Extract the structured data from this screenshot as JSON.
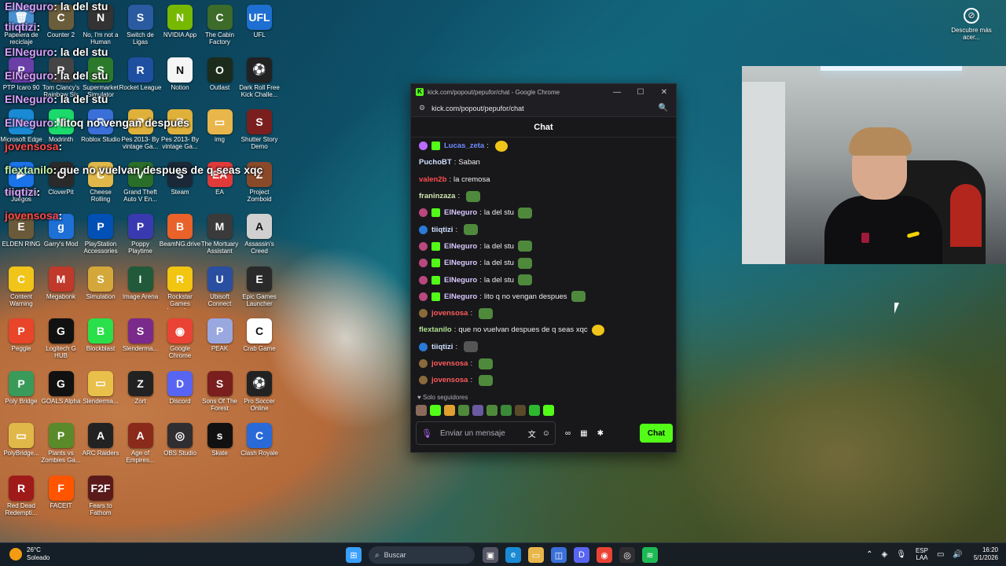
{
  "desktop_icons": [
    {
      "label": "Papelera de reciclaje",
      "color": "#4a8fd0",
      "glyph": "🗑"
    },
    {
      "label": "Counter 2",
      "color": "#6a5d3b",
      "glyph": "C"
    },
    {
      "label": "No, I'm not a Human",
      "color": "#333",
      "glyph": "N"
    },
    {
      "label": "Switch de Ligas",
      "color": "#2a5aa0",
      "glyph": "S"
    },
    {
      "label": "NVIDIA App",
      "color": "#76b900",
      "glyph": "N"
    },
    {
      "label": "The Cabin Factory",
      "color": "#3d6b2a",
      "glyph": "C"
    },
    {
      "label": "UFL",
      "color": "#1d6fd1",
      "glyph": "UFL"
    },
    {
      "label": "PTP Icaro 90",
      "color": "#6a3fa8",
      "glyph": "P"
    },
    {
      "label": "Tom Clancy's Rainbow Six",
      "color": "#444",
      "glyph": "R"
    },
    {
      "label": "Supermarket Simulator",
      "color": "#2b7a2b",
      "glyph": "S"
    },
    {
      "label": "Rocket League",
      "color": "#1f4fa0",
      "glyph": "R"
    },
    {
      "label": "Notion",
      "color": "#f5f5f5",
      "glyph": "N"
    },
    {
      "label": "Outlast",
      "color": "#1c2c1c",
      "glyph": "O"
    },
    {
      "label": "Dark Roll Free Kick Challe...",
      "color": "#222",
      "glyph": "⚽"
    },
    {
      "label": "Microsoft Edge",
      "color": "#1a8ad4",
      "glyph": "e"
    },
    {
      "label": "Modrinth",
      "color": "#1bd96a",
      "glyph": "M"
    },
    {
      "label": "Roblox Studio",
      "color": "#3a6fd8",
      "glyph": "R"
    },
    {
      "label": "Pes 2013- By vintage Ga...",
      "color": "#e0b13a",
      "glyph": "P"
    },
    {
      "label": "Pes 2013- By vintage Ga...",
      "color": "#e0b13a",
      "glyph": "P"
    },
    {
      "label": "img",
      "color": "#e8b64a",
      "glyph": "▭"
    },
    {
      "label": "Shutter Story Demo",
      "color": "#7a1e1e",
      "glyph": "S"
    },
    {
      "label": "Google Play Juegos",
      "color": "#1a73e8",
      "glyph": "▶"
    },
    {
      "label": "CloverPit",
      "color": "#2a2a2a",
      "glyph": "C"
    },
    {
      "label": "Cheese Rolling",
      "color": "#e0b84a",
      "glyph": "C"
    },
    {
      "label": "Grand Theft Auto V En...",
      "color": "#2a6e2a",
      "glyph": "V"
    },
    {
      "label": "Steam",
      "color": "#1b2838",
      "glyph": "S"
    },
    {
      "label": "EA",
      "color": "#e03a3a",
      "glyph": "EA"
    },
    {
      "label": "Project Zomboid",
      "color": "#8a4a2a",
      "glyph": "Z"
    },
    {
      "label": "ELDEN RING",
      "color": "#6a5a3a",
      "glyph": "E"
    },
    {
      "label": "Garry's Mod",
      "color": "#1e6fd6",
      "glyph": "g"
    },
    {
      "label": "PlayStation Accessories",
      "color": "#0050b5",
      "glyph": "P"
    },
    {
      "label": "Poppy Playtime",
      "color": "#3a3ab0",
      "glyph": "P"
    },
    {
      "label": "BeamNG.drive",
      "color": "#e8622a",
      "glyph": "B"
    },
    {
      "label": "The Mortuary Assistant",
      "color": "#3a3a3a",
      "glyph": "M"
    },
    {
      "label": "Assassin's Creed",
      "color": "#d0d0d0",
      "glyph": "A"
    },
    {
      "label": "Content Warning",
      "color": "#f0c419",
      "glyph": "C"
    },
    {
      "label": "Megabonk",
      "color": "#c0392b",
      "glyph": "M"
    },
    {
      "label": "Simulation",
      "color": "#d4a73a",
      "glyph": "S"
    },
    {
      "label": "Image Arena",
      "color": "#205a3a",
      "glyph": "I"
    },
    {
      "label": "Rockstar Games Launcher",
      "color": "#f2c511",
      "glyph": "R"
    },
    {
      "label": "Ubisoft Connect",
      "color": "#2a4fa0",
      "glyph": "U"
    },
    {
      "label": "Epic Games Launcher",
      "color": "#2a2a2a",
      "glyph": "E"
    },
    {
      "label": "Peggle",
      "color": "#e8452a",
      "glyph": "P"
    },
    {
      "label": "Logitech G HUB",
      "color": "#111",
      "glyph": "G"
    },
    {
      "label": "Blockblast",
      "color": "#2ae04a",
      "glyph": "B"
    },
    {
      "label": "Slenderma...",
      "color": "#7a2a8a",
      "glyph": "S"
    },
    {
      "label": "Google Chrome",
      "color": "#ea4335",
      "glyph": "◉"
    },
    {
      "label": "PEAK",
      "color": "#9aa8e0",
      "glyph": "P"
    },
    {
      "label": "Crab Game",
      "color": "#ffffff",
      "glyph": "C"
    },
    {
      "label": "Poly Bridge",
      "color": "#3a9a5a",
      "glyph": "P"
    },
    {
      "label": "GOALS Alpha",
      "color": "#111",
      "glyph": "G"
    },
    {
      "label": "Slenderma...",
      "color": "#e8c04a",
      "glyph": "▭"
    },
    {
      "label": "Zort",
      "color": "#222",
      "glyph": "Z"
    },
    {
      "label": "Discord",
      "color": "#5865f2",
      "glyph": "D"
    },
    {
      "label": "Sons Of The Forest",
      "color": "#7a1e1e",
      "glyph": "S"
    },
    {
      "label": "Pro Soccer Online",
      "color": "#222",
      "glyph": "⚽"
    },
    {
      "label": "PolyBridge...",
      "color": "#e0b84a",
      "glyph": "▭"
    },
    {
      "label": "Plants vs Zombies Ga...",
      "color": "#5a8a2a",
      "glyph": "P"
    },
    {
      "label": "ARC Raiders",
      "color": "#222",
      "glyph": "A"
    },
    {
      "label": "Age of Empires...",
      "color": "#8a2a1a",
      "glyph": "A"
    },
    {
      "label": "OBS Studio",
      "color": "#302e31",
      "glyph": "◎"
    },
    {
      "label": "Skate",
      "color": "#111",
      "glyph": "s"
    },
    {
      "label": "Clash Royale",
      "color": "#2a6ad8",
      "glyph": "C"
    },
    {
      "label": "Red Dead Redempti...",
      "color": "#a01a1a",
      "glyph": "R"
    },
    {
      "label": "FACEIT",
      "color": "#ff5500",
      "glyph": "F"
    },
    {
      "label": "Fears to Fathom",
      "color": "#5a1a1a",
      "glyph": "F2F"
    }
  ],
  "overlay_lines": [
    {
      "user": "ElNeguro",
      "text": "la del stu"
    },
    {
      "user": "tiiqtizi",
      "text": ""
    },
    {
      "user": "ElNeguro",
      "text": "la del stu"
    },
    {
      "user": "ElNeguro",
      "text": "la del stu"
    },
    {
      "user": "ElNeguro",
      "text": "la del stu"
    },
    {
      "user": "ElNeguro",
      "text": "litoq no vengan despues"
    },
    {
      "user": "jovensosa",
      "text": ""
    },
    {
      "user": "flextanilo",
      "text": "que no vuelvan despues de q seas xqc"
    },
    {
      "user": "tiiqtizi",
      "text": ""
    },
    {
      "user": "jovensosa",
      "text": ""
    }
  ],
  "top_right_shortcut": {
    "label": "Descubre más acer...",
    "icon": "compass-icon"
  },
  "chat_window": {
    "title": "kick.com/popout/pepufor/chat - Google Chrome",
    "url": "kick.com/popout/pepufor/chat",
    "header": "Chat",
    "messages": [
      {
        "user": "Lucas_zeta",
        "text": "",
        "color": "#6e8cff",
        "badge": "#b96cff",
        "sub": true,
        "emote": "yellow"
      },
      {
        "user": "PuchoBT",
        "text": "Saban",
        "color": "#cfe0ff",
        "badge": "",
        "sub": false,
        "emote": ""
      },
      {
        "user": "valen2b",
        "text": "la cremosa",
        "color": "#ff4d4d",
        "badge": "",
        "sub": false,
        "emote": ""
      },
      {
        "user": "franinzaza",
        "text": "",
        "color": "#cfe7b0",
        "badge": "",
        "sub": false,
        "emote": "green"
      },
      {
        "user": "ElNeguro",
        "text": "la del stu",
        "color": "#d9c7ff",
        "badge": "#b9487d",
        "sub": true,
        "emote": "green"
      },
      {
        "user": "tiiqtizi",
        "text": "",
        "color": "#cfe0ff",
        "badge": "#2a7ad8",
        "sub": false,
        "emote": "green"
      },
      {
        "user": "ElNeguro",
        "text": "la del stu",
        "color": "#d9c7ff",
        "badge": "#b9487d",
        "sub": true,
        "emote": "green"
      },
      {
        "user": "ElNeguro",
        "text": "la del stu",
        "color": "#d9c7ff",
        "badge": "#b9487d",
        "sub": true,
        "emote": "green"
      },
      {
        "user": "ElNeguro",
        "text": "la del stu",
        "color": "#d9c7ff",
        "badge": "#b9487d",
        "sub": true,
        "emote": "green"
      },
      {
        "user": "ElNeguro",
        "text": "lito q no vengan despues",
        "color": "#d9c7ff",
        "badge": "#b9487d",
        "sub": true,
        "emote": "green"
      },
      {
        "user": "jovensosa",
        "text": "",
        "color": "#ff5a5a",
        "badge": "#8a6a3a",
        "sub": false,
        "emote": "green"
      },
      {
        "user": "flextanilo",
        "text": "que no vuelvan despues de q seas xqc",
        "color": "#b0e090",
        "badge": "",
        "sub": false,
        "emote": "yellow"
      },
      {
        "user": "tiiqtizi",
        "text": "",
        "color": "#cfe0ff",
        "badge": "#2a7ad8",
        "sub": false,
        "emote": "gray"
      },
      {
        "user": "jovensosa",
        "text": "",
        "color": "#ff5a5a",
        "badge": "#8a6a3a",
        "sub": false,
        "emote": "green"
      },
      {
        "user": "jovensosa",
        "text": "",
        "color": "#ff5a5a",
        "badge": "#8a6a3a",
        "sub": false,
        "emote": "green"
      }
    ],
    "followers_only": "Solo seguidores",
    "input_placeholder": "Enviar un mensaje",
    "send_label": "Chat",
    "accent": "#53fc18"
  },
  "taskbar": {
    "weather_temp": "26°C",
    "weather_desc": "Soleado",
    "search_placeholder": "Buscar",
    "lang_line1": "ESP",
    "lang_line2": "LAA",
    "time": "16:20",
    "date": "5/1/2026"
  }
}
